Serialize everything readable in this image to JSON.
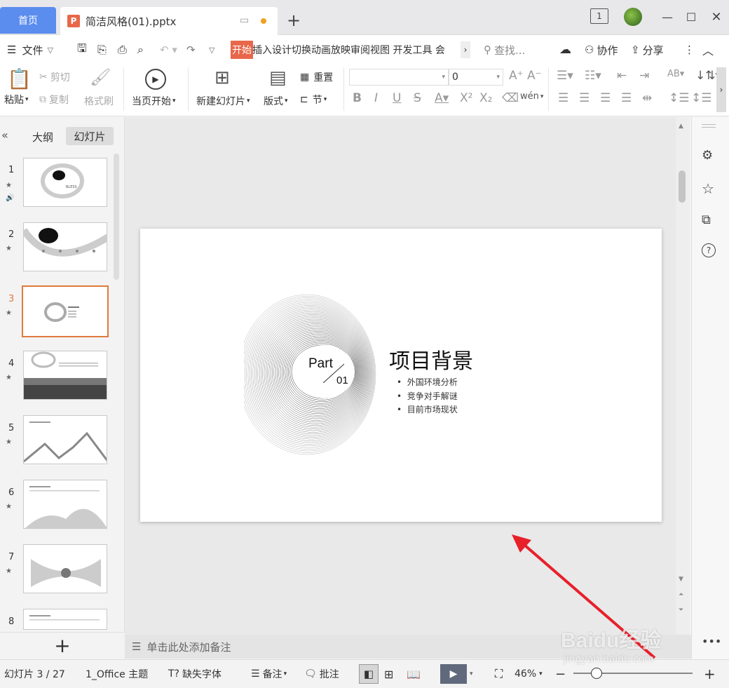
{
  "tabs": {
    "home": "首页",
    "doc_title": "简洁风格(01).pptx",
    "ppt_icon": "P"
  },
  "window": {
    "badge": "1"
  },
  "menu": {
    "file": "文件",
    "start": "开始",
    "rest": "插入设计切换动画放映审阅视图 开发工具 会",
    "search": "查找...",
    "collab": "协作",
    "share": "分享"
  },
  "ribbon": {
    "paste": "粘贴",
    "cut": "剪切",
    "copy": "复制",
    "format_painter": "格式刷",
    "from_current": "当页开始",
    "new_slide": "新建幻灯片",
    "layout": "版式",
    "reset": "重置",
    "section": "节",
    "font_size": "0",
    "phonetic": "wén"
  },
  "leftpanel": {
    "outline_tab": "大纲",
    "slides_tab": "幻灯片",
    "slide_numbers": [
      "1",
      "2",
      "3",
      "4",
      "5",
      "6",
      "7",
      "8"
    ],
    "selected": "3",
    "add": "+"
  },
  "slide": {
    "part": "Part",
    "num": "01",
    "title": "项目背景",
    "bullets": [
      "外国环境分析",
      "竞争对手解谜",
      "目前市场现状"
    ]
  },
  "notes": {
    "placeholder": "单击此处添加备注"
  },
  "status": {
    "slide_counter": "幻灯片 3 / 27",
    "theme": "1_Office 主题",
    "missing_font": "缺失字体",
    "notes": "备注",
    "comments": "批注",
    "zoom": "46%"
  },
  "watermark": {
    "brand": "Baidu经验",
    "url": "jingyan.baidu.com"
  },
  "colors": {
    "accent_orange": "#e07a3b",
    "home_blue": "#5b8def",
    "arrow_red": "#e8202a"
  }
}
